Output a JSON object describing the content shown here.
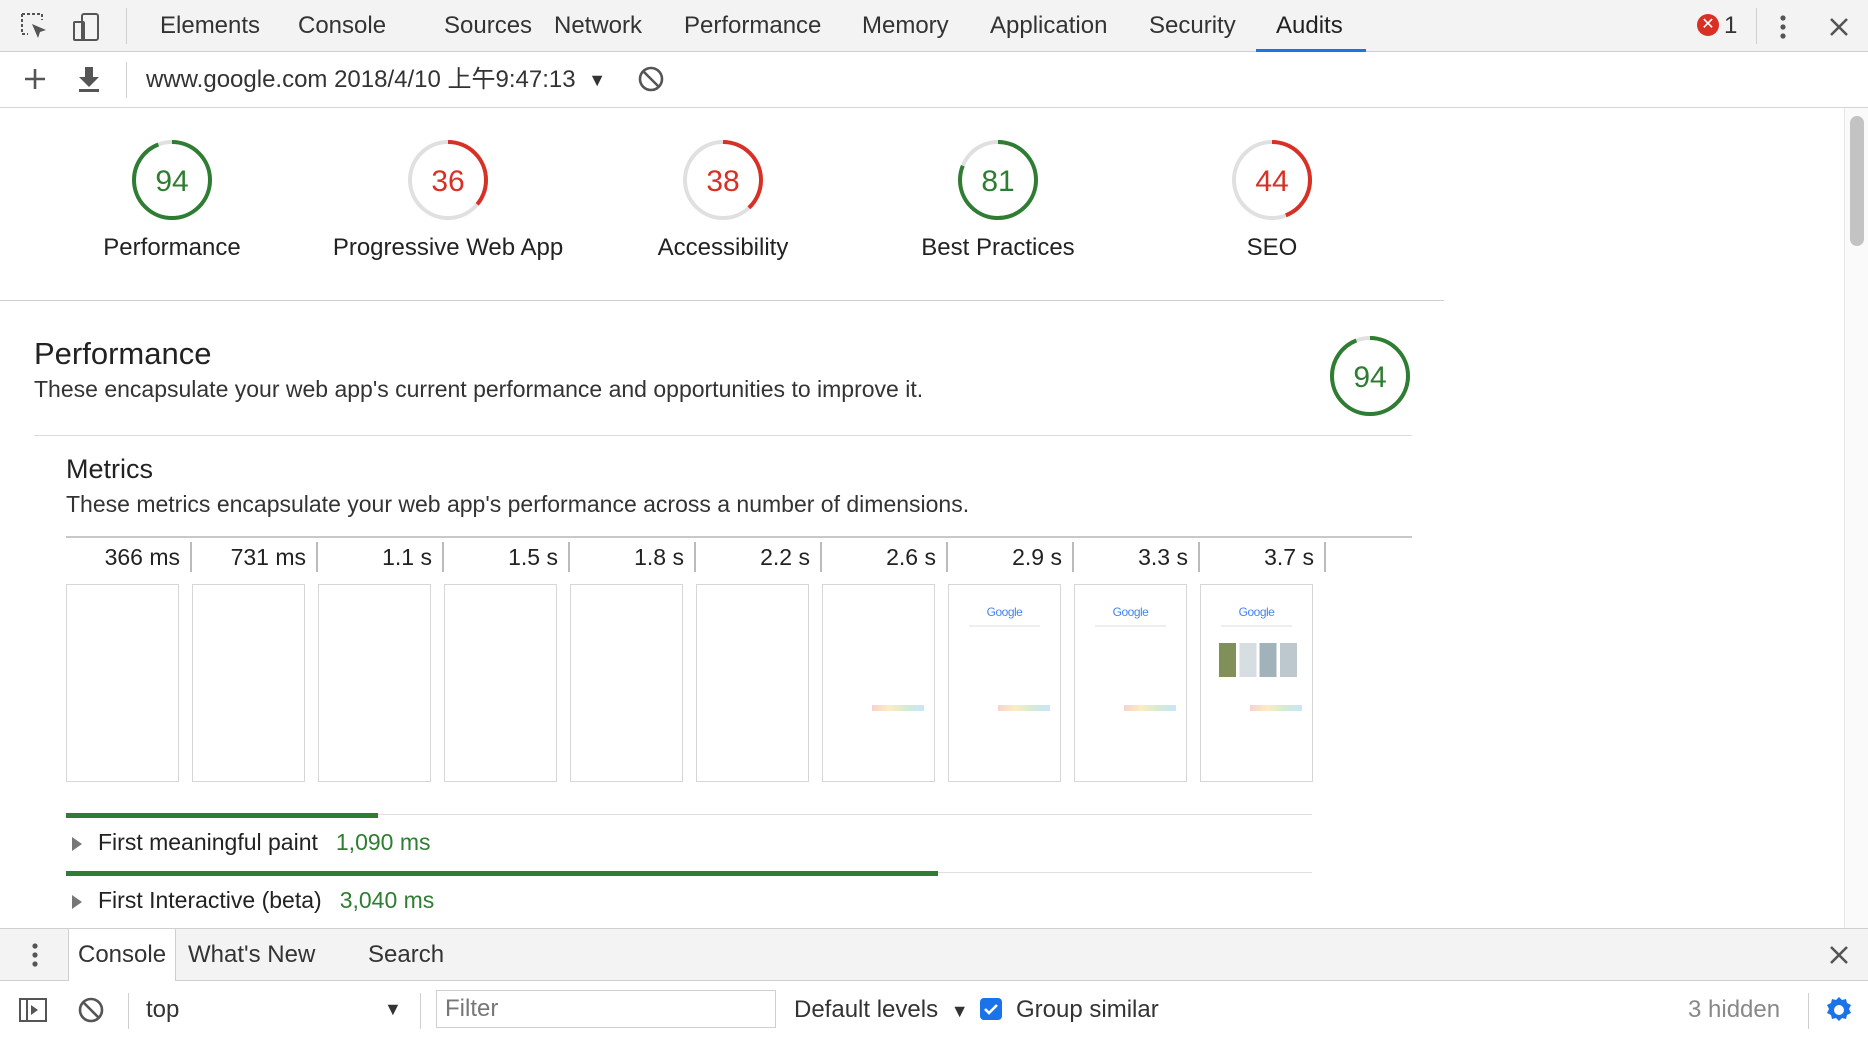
{
  "tabs": [
    {
      "label": "Elements"
    },
    {
      "label": "Console"
    },
    {
      "label": "Sources"
    },
    {
      "label": "Network"
    },
    {
      "label": "Performance"
    },
    {
      "label": "Memory"
    },
    {
      "label": "Application"
    },
    {
      "label": "Security"
    },
    {
      "label": "Audits"
    }
  ],
  "active_tab": "Audits",
  "error_count": "1",
  "toolbar": {
    "report_label": "www.google.com 2018/4/10 上午9:47:13"
  },
  "gauges": [
    {
      "score": "94",
      "label": "Performance",
      "status": "pass",
      "color": "#2e7d32",
      "fraction": 0.94
    },
    {
      "score": "36",
      "label": "Progressive Web App",
      "status": "fail",
      "color": "#d93025",
      "fraction": 0.36
    },
    {
      "score": "38",
      "label": "Accessibility",
      "status": "fail",
      "color": "#d93025",
      "fraction": 0.38
    },
    {
      "score": "81",
      "label": "Best Practices",
      "status": "pass",
      "color": "#2e7d32",
      "fraction": 0.81
    },
    {
      "score": "44",
      "label": "SEO",
      "status": "fail",
      "color": "#d93025",
      "fraction": 0.44
    }
  ],
  "performance": {
    "title": "Performance",
    "description": "These encapsulate your web app's current performance and opportunities to improve it.",
    "score": "94",
    "score_fraction": 0.94,
    "metrics_title": "Metrics",
    "metrics_description": "These metrics encapsulate your web app's performance across a number of dimensions.",
    "filmstrip": [
      {
        "time": "366 ms",
        "content": "blank"
      },
      {
        "time": "731 ms",
        "content": "blank"
      },
      {
        "time": "1.1 s",
        "content": "blank"
      },
      {
        "time": "1.5 s",
        "content": "blank"
      },
      {
        "time": "1.8 s",
        "content": "blank"
      },
      {
        "time": "2.2 s",
        "content": "blank"
      },
      {
        "time": "2.6 s",
        "content": "footer"
      },
      {
        "time": "2.9 s",
        "content": "logo"
      },
      {
        "time": "3.3 s",
        "content": "logo"
      },
      {
        "time": "3.7 s",
        "content": "logo-thumbs"
      }
    ],
    "frame_logo_text": "Google",
    "metrics": [
      {
        "name": "First meaningful paint",
        "value": "1,090 ms",
        "bar_fraction": 0.25
      },
      {
        "name": "First Interactive (beta)",
        "value": "3,040 ms",
        "bar_fraction": 0.7
      }
    ]
  },
  "drawer": {
    "tabs": [
      {
        "label": "Console"
      },
      {
        "label": "What's New"
      },
      {
        "label": "Search"
      }
    ],
    "context": "top",
    "filter_placeholder": "Filter",
    "levels_label": "Default levels",
    "group_similar_label": "Group similar",
    "group_similar_checked": true,
    "hidden_count": "3 hidden"
  },
  "colors": {
    "pass": "#2e7d32",
    "fail": "#d93025",
    "accent": "#1a73e8"
  }
}
